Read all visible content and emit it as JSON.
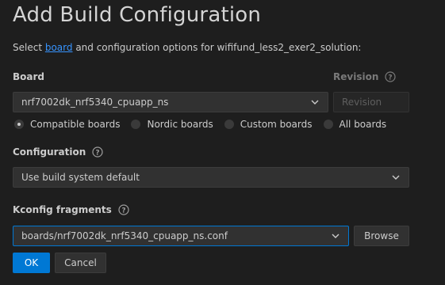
{
  "dialog": {
    "title": "Add Build Configuration",
    "subtitle": {
      "prefix": "Select ",
      "link": "board",
      "suffix": " and configuration options for wififund_less2_exer2_solution:"
    }
  },
  "board": {
    "label": "Board",
    "selected": "nrf7002dk_nrf5340_cpuapp_ns",
    "radios": [
      {
        "label": "Compatible boards",
        "checked": true
      },
      {
        "label": "Nordic boards",
        "checked": false
      },
      {
        "label": "Custom boards",
        "checked": false
      },
      {
        "label": "All boards",
        "checked": false
      }
    ]
  },
  "revision": {
    "label": "Revision",
    "placeholder": "Revision"
  },
  "configuration": {
    "label": "Configuration",
    "selected": "Use build system default"
  },
  "kconfig": {
    "label": "Kconfig fragments",
    "selected": "boards/nrf7002dk_nrf5340_cpuapp_ns.conf",
    "browse_label": "Browse"
  },
  "actions": {
    "ok_label": "OK",
    "cancel_label": "Cancel"
  },
  "icons": {
    "help": "help-circle-icon",
    "dropdown": "chevron-down-icon"
  },
  "colors": {
    "background": "#1e1e1e",
    "accent": "#0078d4",
    "link": "#3794ff"
  }
}
